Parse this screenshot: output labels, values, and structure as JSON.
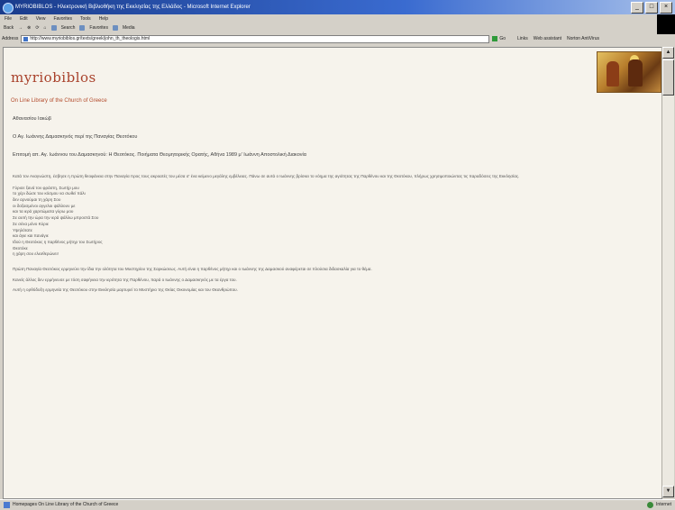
{
  "window": {
    "title": "MYRIOBIBLOS - Ηλεκτρονική Βιβλιοθήκη της Εκκλησίας της Ελλάδος - Microsoft Internet Explorer",
    "controls": [
      "_",
      "□",
      "×"
    ]
  },
  "menu": [
    "File",
    "Edit",
    "View",
    "Favorites",
    "Tools",
    "Help"
  ],
  "toolbar": {
    "back": "Back",
    "forward": "→",
    "stop": "⊗",
    "refresh": "⟳",
    "home": "⌂",
    "search": "Search",
    "favorites": "Favorites",
    "media": "Media"
  },
  "address": {
    "label": "Address",
    "value": "http://www.myriobiblos.gr/texts/greek/john_th_theologis.html",
    "go": "Go",
    "links": [
      "Links",
      "Web assistant",
      "Norton AntiVirus"
    ]
  },
  "page": {
    "logo": "myriobiblos",
    "subtitle": "On Line Library of the Church of Greece",
    "meta1": "Αθανασίου Ιακώβ",
    "meta2": "Ο Αγ. Ιωάννης Δαμασκηνός περί της Παναγίας Θεοτόκου",
    "meta3": "Επιτομή απ. Αγ. Ιωάννου του Δαμασκηνού: Η Θεοτόκος. Ποιήματα Θεομητορικής Ορατής, Αθήνα 1989 μ' Ιωάννη Αποστολική Διακονία",
    "intro": "Κατά τον Αναγνώστη, έσβησε η πρώτη θεοφάνεια στην Παναγία προς τους ακροατές του μέσα σ' ένα κείμενο μεγάλης εμβέλειας. Πάνω σε αυτά ο Ιωάννης βρίσκει το νόημα της αγιότητας της Παρθένου και της Θεοτόκου, πλήρως χρησιμοποιώντας τις παραδόσεις της Εκκλησίας.",
    "poem": [
      "Γύρισε ξανά τον φράστη, Σωτήρ μου",
      "το χέρι δώσε του κόσμου να σωθεί πάλι",
      "δεν αρνούμαι τη χάρη Σου",
      "οι δοξασμένοι αγγελοι ψάλλουν με",
      "και τα ιερά χαριτώματα γύρω μου",
      "Σε αυτή την ώρα την ιερά ψάλλω μπροστά Σου",
      "Σε σένα μόνο Κύριε",
      "Υψηλότατε",
      "και άγιε και πανάγιε",
      "Ιδού η Θεοτόκος η παρθένος μήτηρ του Σωτήρος",
      "Θεοτόκε",
      "η χάρη σου ελευθερώνει!"
    ],
    "para1": "Πρώτη Παναγία Θεοτόκος ερμηνεύει την ίδια την ολότητα του Μυστηρίου της Σαρκώσεως. Αυτή είναι η παρθένος μήτηρ και ο Ιωάννης της Δαμασκού αναφέρεται σε πλούσια διδασκαλία για το θέμα.",
    "para2": "Κανείς άλλος δεν ερμήνευσε με τόση σαφήνεια την ιερότητα της Παρθένου, παρά ο Ιωάννης ο Δαμασκηνός με τα έργα του.",
    "para3": "Αυτή η ορθόδοξη ερμηνεία της Θεοτόκου στην Εκκλησία μαρτυρεί το Μυστήριο της Θείας Οικονομίας και του Θεανθρώπου."
  },
  "status": {
    "text": "Homepages On Line Library of the Church of Greece",
    "zone": "Internet"
  }
}
